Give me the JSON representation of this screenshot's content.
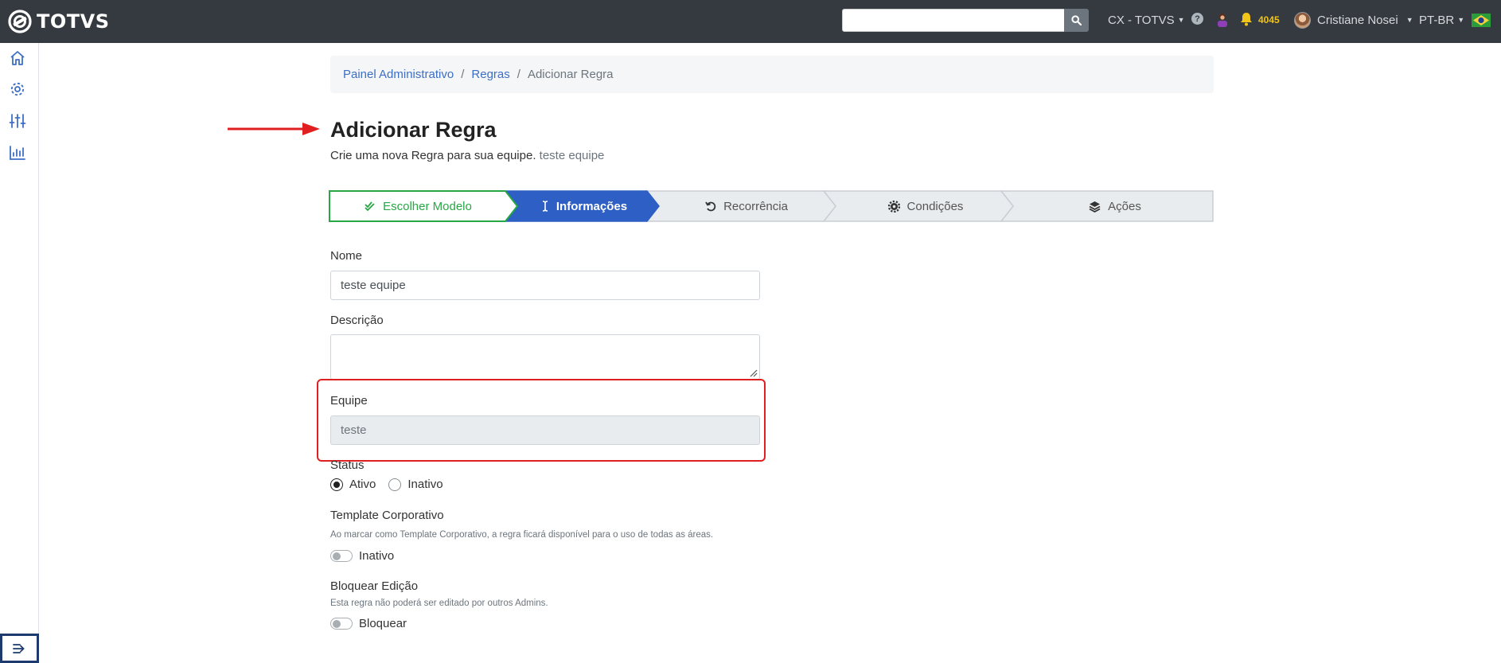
{
  "brand": {
    "name": "TOTVS"
  },
  "topbar": {
    "search": {
      "value": "",
      "placeholder": ""
    },
    "workspace": "CX - TOTVS",
    "notifications": "4045",
    "user": "Cristiane Nosei",
    "language": "PT-BR"
  },
  "sidebar": {
    "items": [
      {
        "icon": "home-icon"
      },
      {
        "icon": "settings-icon"
      },
      {
        "icon": "sliders-icon"
      },
      {
        "icon": "chart-icon"
      }
    ],
    "toggle_icon": "expand-menu-icon"
  },
  "breadcrumb": [
    "Painel Administrativo",
    "Regras",
    "Adicionar Regra"
  ],
  "page": {
    "title": "Adicionar Regra",
    "subtitle": "Crie uma nova Regra para sua equipe.",
    "team": "teste equipe"
  },
  "stepper": {
    "steps": [
      {
        "label": "Escolher Modelo",
        "icon": "double-check-icon",
        "state": "done"
      },
      {
        "label": "Informações",
        "icon": "text-cursor-icon",
        "state": "active"
      },
      {
        "label": "Recorrência",
        "icon": "undo-icon",
        "state": "pending"
      },
      {
        "label": "Condições",
        "icon": "gear-icon",
        "state": "pending"
      },
      {
        "label": "Ações",
        "icon": "layers-icon",
        "state": "pending"
      }
    ],
    "colors": {
      "done": "#28a745",
      "active": "#2d5fc4",
      "pending": "#e9ecef"
    }
  },
  "form": {
    "name_label": "Nome",
    "name_value": "teste equipe",
    "description_label": "Descrição",
    "description_value": "",
    "team_label": "Equipe",
    "team_value": "teste",
    "status_label": "Status",
    "status_options": [
      "Ativo",
      "Inativo"
    ],
    "status_selected": "Ativo",
    "template_label": "Template Corporativo",
    "template_help": "Ao marcar como Template Corporativo, a regra ficará disponível para o uso de todas as áreas.",
    "template_toggle_label": "Inativo",
    "template_enabled": false,
    "lock_label": "Bloquear Edição",
    "lock_help": "Esta regra não poderá ser editado por outros Admins.",
    "lock_toggle_label": "Bloquear",
    "lock_enabled": false
  },
  "annotations": {
    "color": "#e02020"
  }
}
